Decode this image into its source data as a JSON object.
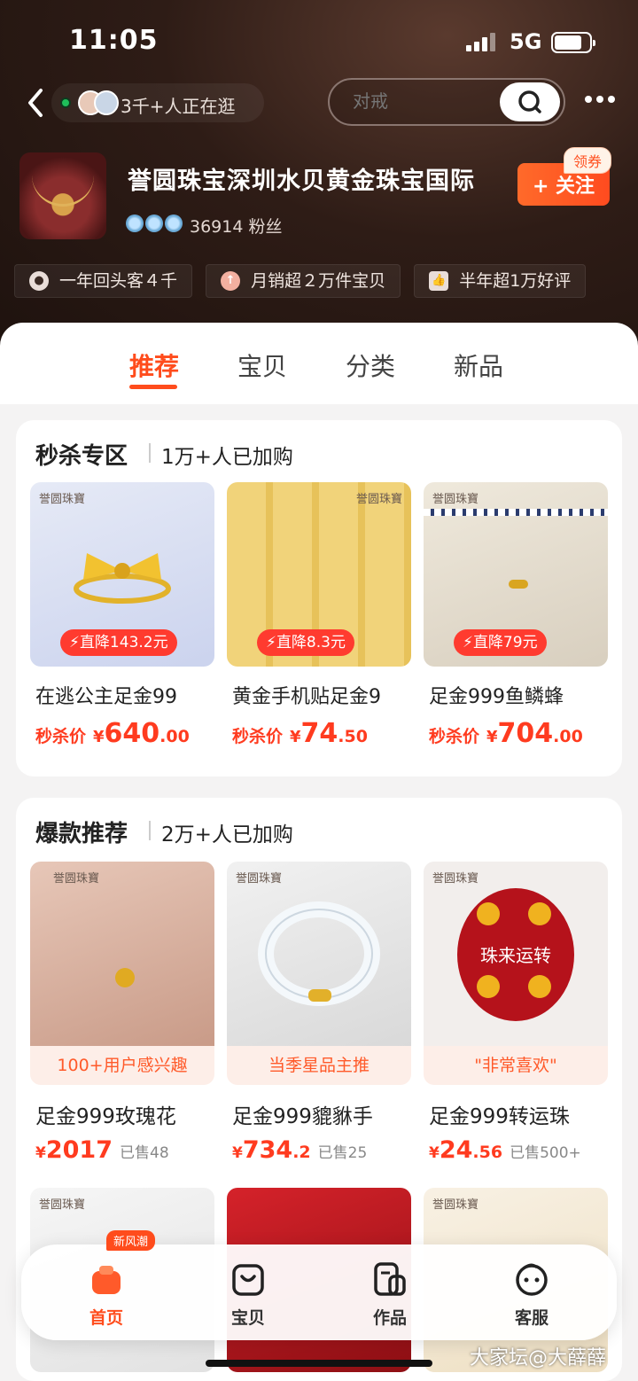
{
  "status": {
    "time": "11:05",
    "network": "5G"
  },
  "header": {
    "visitors": "3千+人正在逛",
    "search_placeholder": "对戒"
  },
  "shop": {
    "name": "誉圆珠宝深圳水贝黄金珠宝国际",
    "fans": "36914 粉丝",
    "follow_label": "+ 关注",
    "coupon_label": "领券"
  },
  "highlights": [
    {
      "icon": "user-icon",
      "label": "一年回头客４千"
    },
    {
      "icon": "up-arrow-icon",
      "label": "月销超２万件宝贝"
    },
    {
      "icon": "thumbs-up-icon",
      "label": "半年超1万好评"
    }
  ],
  "tabs": [
    {
      "label": "推荐",
      "active": true
    },
    {
      "label": "宝贝",
      "active": false
    },
    {
      "label": "分类",
      "active": false
    },
    {
      "label": "新品",
      "active": false
    }
  ],
  "flash_sale": {
    "title": "秒杀专区",
    "subtitle": "1万+人已加购",
    "items": [
      {
        "watermark": "誉圆珠寶",
        "drop": "直降143.2元",
        "title": "在逃公主足金99",
        "price_label": "秒杀价",
        "currency": "¥",
        "price_int": "640",
        "price_dec": ".00"
      },
      {
        "watermark": "誉圆珠寶",
        "drop": "直降8.3元",
        "title": "黄金手机贴足金9",
        "price_label": "秒杀价",
        "currency": "¥",
        "price_int": "74",
        "price_dec": ".50"
      },
      {
        "watermark": "誉圆珠寶",
        "drop": "直降79元",
        "title": "足金999鱼鳞蜂",
        "price_label": "秒杀价",
        "currency": "¥",
        "price_int": "704",
        "price_dec": ".00"
      }
    ]
  },
  "hot": {
    "title": "爆款推荐",
    "subtitle": "2万+人已加购",
    "items": [
      {
        "watermark": "誉圆珠寶",
        "tag": "100+用户感兴趣",
        "title": "足金999玫瑰花",
        "currency": "¥",
        "price_int": "2017",
        "price_dec": "",
        "sold": "已售48"
      },
      {
        "watermark": "誉圆珠寶",
        "tag": "当季星品主推",
        "title": "足金999貔貅手",
        "currency": "¥",
        "price_int": "734",
        "price_dec": ".2",
        "sold": "已售25"
      },
      {
        "watermark": "誉圆珠寶",
        "tag": "\"非常喜欢\"",
        "title": "足金999转运珠",
        "currency": "¥",
        "price_int": "24",
        "price_dec": ".56",
        "sold": "已售500+",
        "image_text": "珠来运转"
      }
    ]
  },
  "more_watermarks": [
    "誉圆珠寶",
    "誉圆珠寶"
  ],
  "bottom_nav": {
    "badge": "新风潮",
    "items": [
      {
        "label": "首页",
        "active": true
      },
      {
        "label": "宝贝",
        "active": false
      },
      {
        "label": "作品",
        "active": false
      },
      {
        "label": "客服",
        "active": false
      }
    ]
  },
  "watermark": "大家坛@大薛薛",
  "colors": {
    "accent": "#ff4c1c",
    "header_bg": "#2e1c16"
  }
}
